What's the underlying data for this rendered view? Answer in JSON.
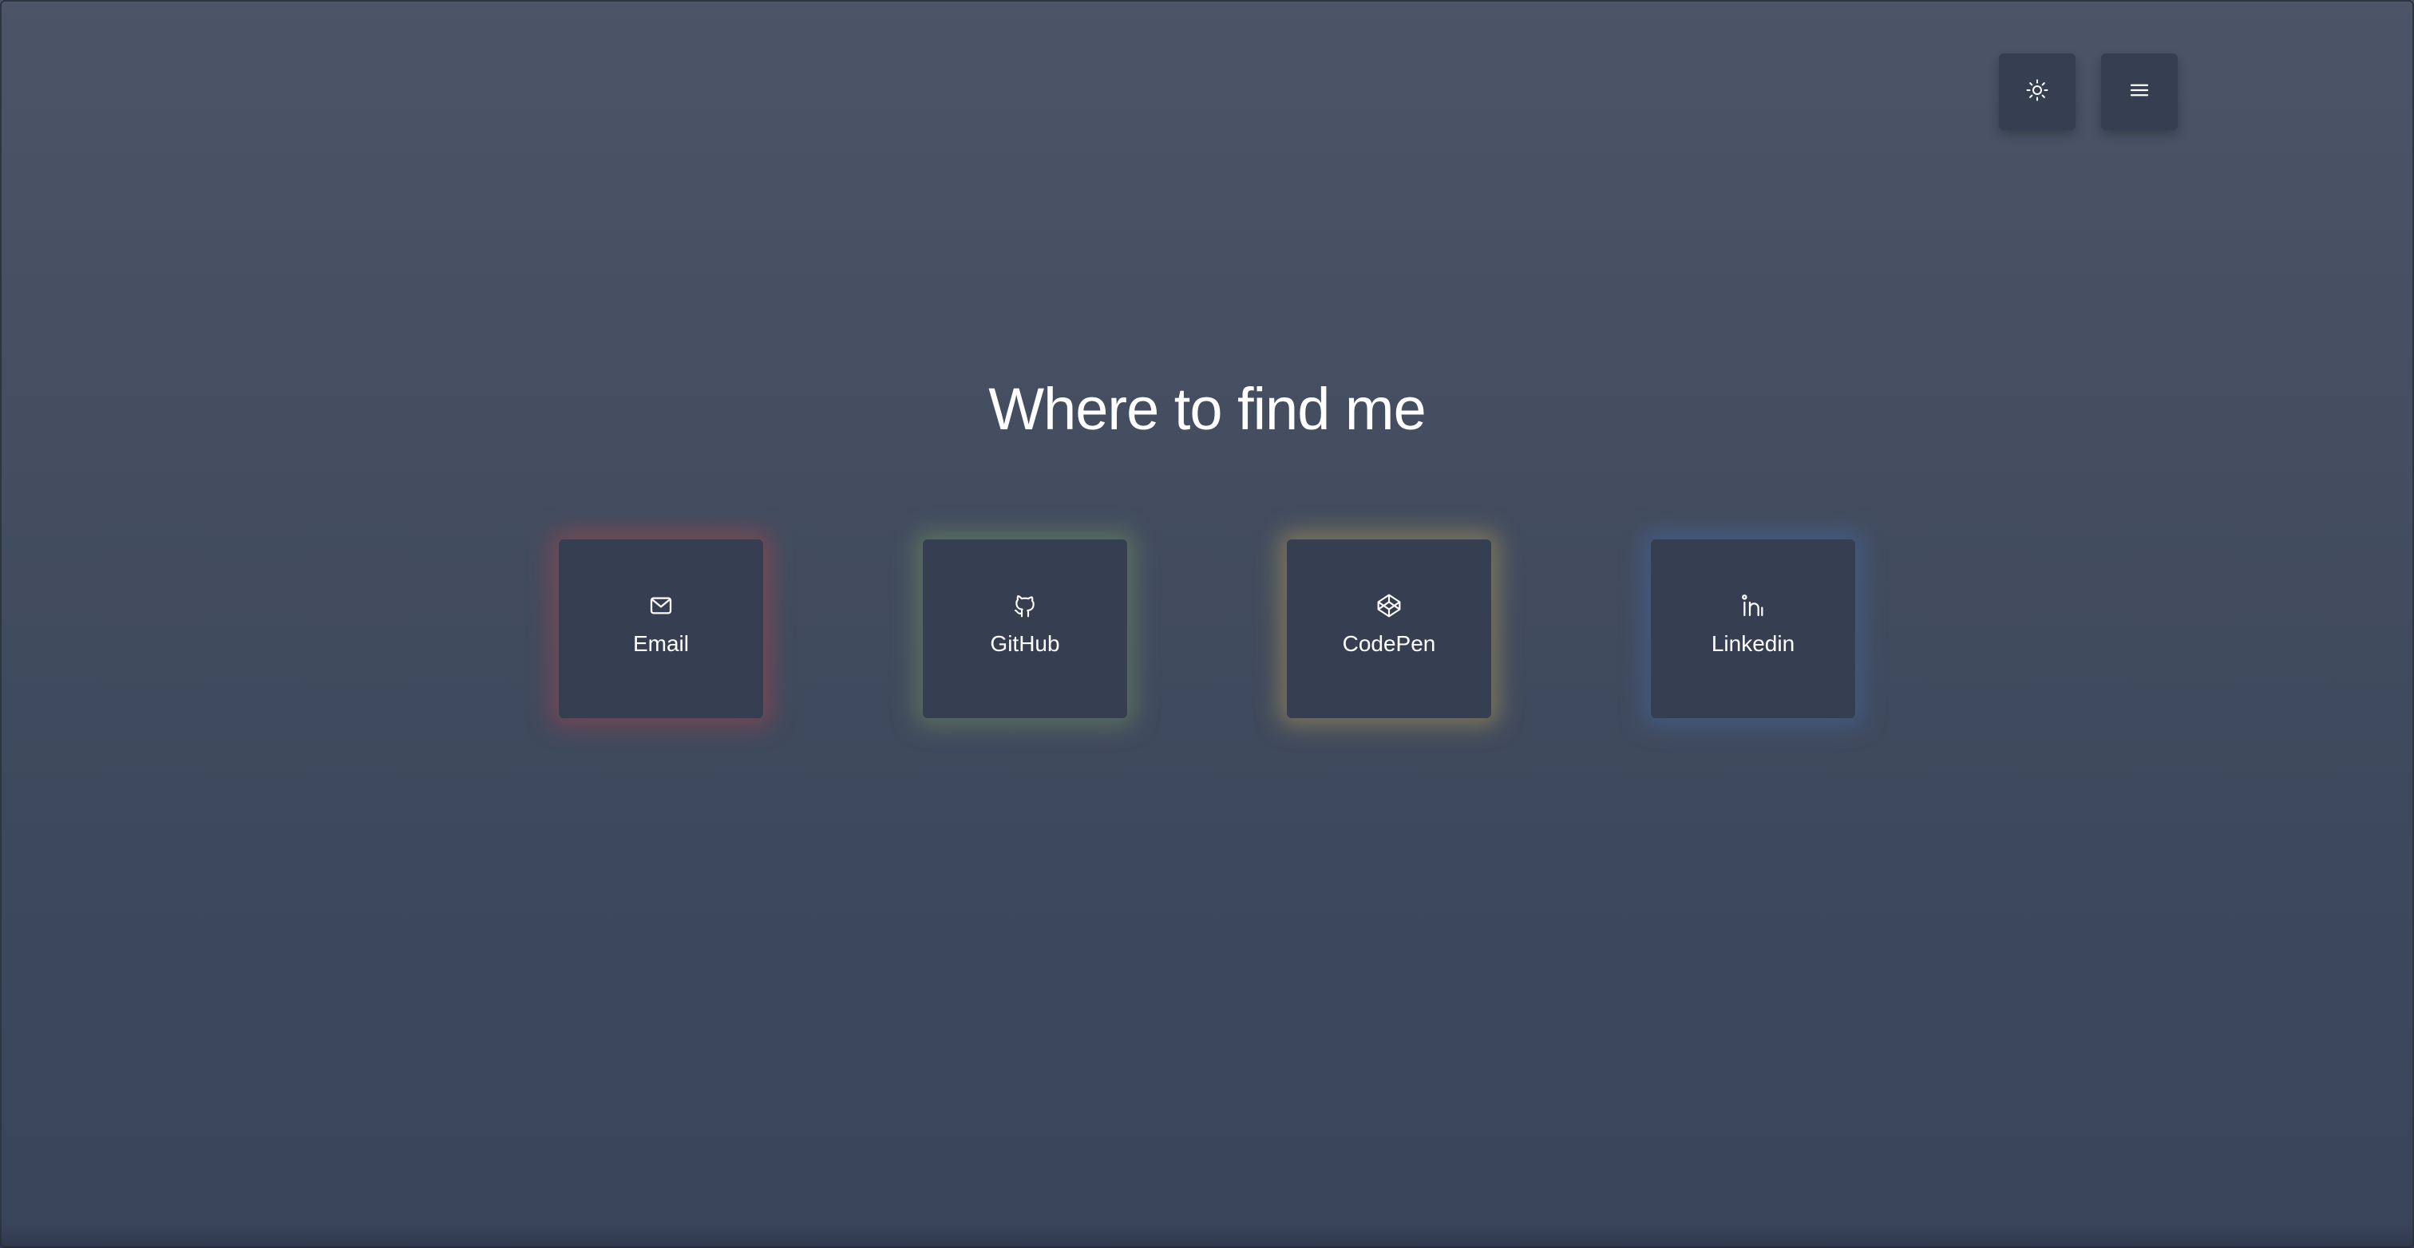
{
  "header": {
    "theme_toggle_icon": "sun-icon",
    "menu_icon": "hamburger-menu-icon"
  },
  "main": {
    "title": "Where to find me",
    "links": [
      {
        "label": "Email",
        "icon": "mail-icon",
        "glow": "#a0464e"
      },
      {
        "label": "GitHub",
        "icon": "github-icon",
        "glow": "#6e8c60"
      },
      {
        "label": "CodePen",
        "icon": "codepen-icon",
        "glow": "#aa965a"
      },
      {
        "label": "Linkedin",
        "icon": "linkedin-icon",
        "glow": "#466496"
      }
    ]
  },
  "colors": {
    "background_top": "#4b5567",
    "background_bottom": "#39435a",
    "card": "#363f52"
  }
}
